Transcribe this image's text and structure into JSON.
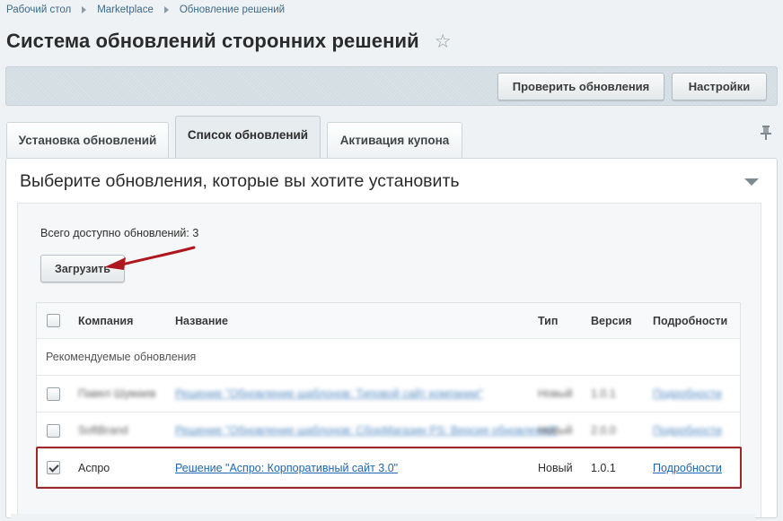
{
  "breadcrumb": {
    "items": [
      "Рабочий стол",
      "Marketplace",
      "Обновление решений"
    ]
  },
  "page_title": "Система обновлений сторонних решений",
  "toolbar": {
    "check_label": "Проверить обновления",
    "settings_label": "Настройки"
  },
  "tabs": [
    {
      "label": "Установка обновлений",
      "active": false
    },
    {
      "label": "Список обновлений",
      "active": true
    },
    {
      "label": "Активация купона",
      "active": false
    }
  ],
  "panel": {
    "header": "Выберите обновления, которые вы хотите установить",
    "total_text": "Всего доступно обновлений: 3",
    "load_label": "Загрузить"
  },
  "table": {
    "columns": [
      "Компания",
      "Название",
      "Тип",
      "Версия",
      "Подробности"
    ],
    "group_label": "Рекомендуемые обновления",
    "rows": [
      {
        "company": "Павел Шумаев",
        "name": "Решение \"Обновление шаблонов: Типовой сайт компании\"",
        "type": "Новый",
        "version": "1.0.1",
        "details": "Подробности",
        "checked": false,
        "obscured": true
      },
      {
        "company": "SoftBrand",
        "name": "Решение \"Обновление шаблонов: СборМагазин PS: Версия обновлений\"",
        "type": "Новый",
        "version": "2.0.0",
        "details": "Подробности",
        "checked": false,
        "obscured": true
      },
      {
        "company": "Аспро",
        "name": "Решение \"Аспро: Корпоративный сайт 3.0\"",
        "type": "Новый",
        "version": "1.0.1",
        "details": "Подробности",
        "checked": true,
        "obscured": false
      }
    ]
  },
  "colors": {
    "highlight": "#a0262d",
    "arrow": "#b0161e",
    "link": "#2067b0"
  },
  "icons": [
    "star-icon",
    "pin-icon",
    "collapse-icon",
    "checkbox-icon",
    "arrow-annotation"
  ]
}
